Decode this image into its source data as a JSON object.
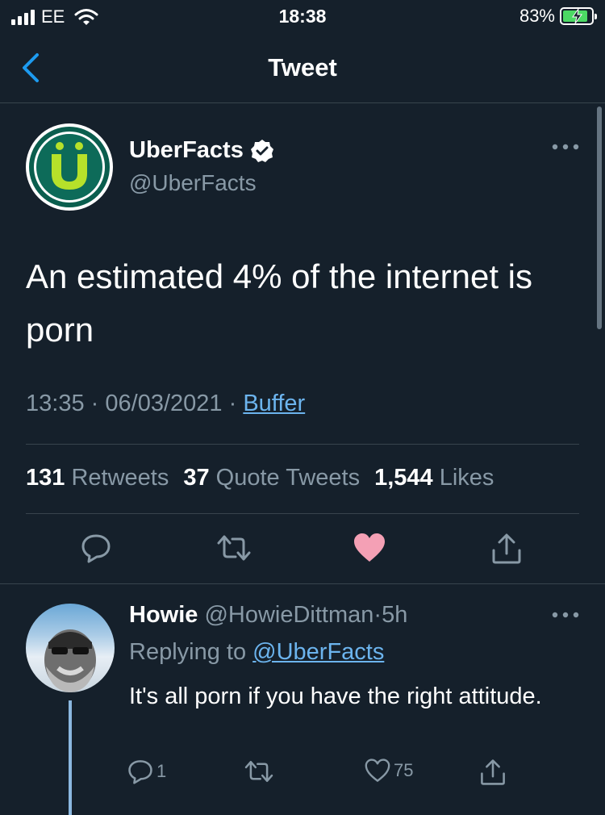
{
  "status_bar": {
    "carrier": "EE",
    "time": "18:38",
    "battery_percent": "83%"
  },
  "nav": {
    "title": "Tweet"
  },
  "tweet": {
    "author_name": "UberFacts",
    "author_handle": "@UberFacts",
    "avatar_letter": "Ü",
    "text": "An estimated 4% of the internet is porn",
    "time": "13:35",
    "date": "06/03/2021",
    "separator": "·",
    "source": "Buffer",
    "stats": {
      "retweets_count": "131",
      "retweets_label": "Retweets",
      "quotes_count": "37",
      "quotes_label": "Quote Tweets",
      "likes_count": "1,544",
      "likes_label": "Likes"
    },
    "liked": true,
    "like_color": "#f4a0b5"
  },
  "reply": {
    "author_name": "Howie",
    "author_handle": "@HowieDittman",
    "age": "5h",
    "replying_prefix": "Replying to",
    "replying_to": "@UberFacts",
    "text": "It's all porn if you have the right attitude.",
    "reply_count": "1",
    "like_count": "75"
  }
}
